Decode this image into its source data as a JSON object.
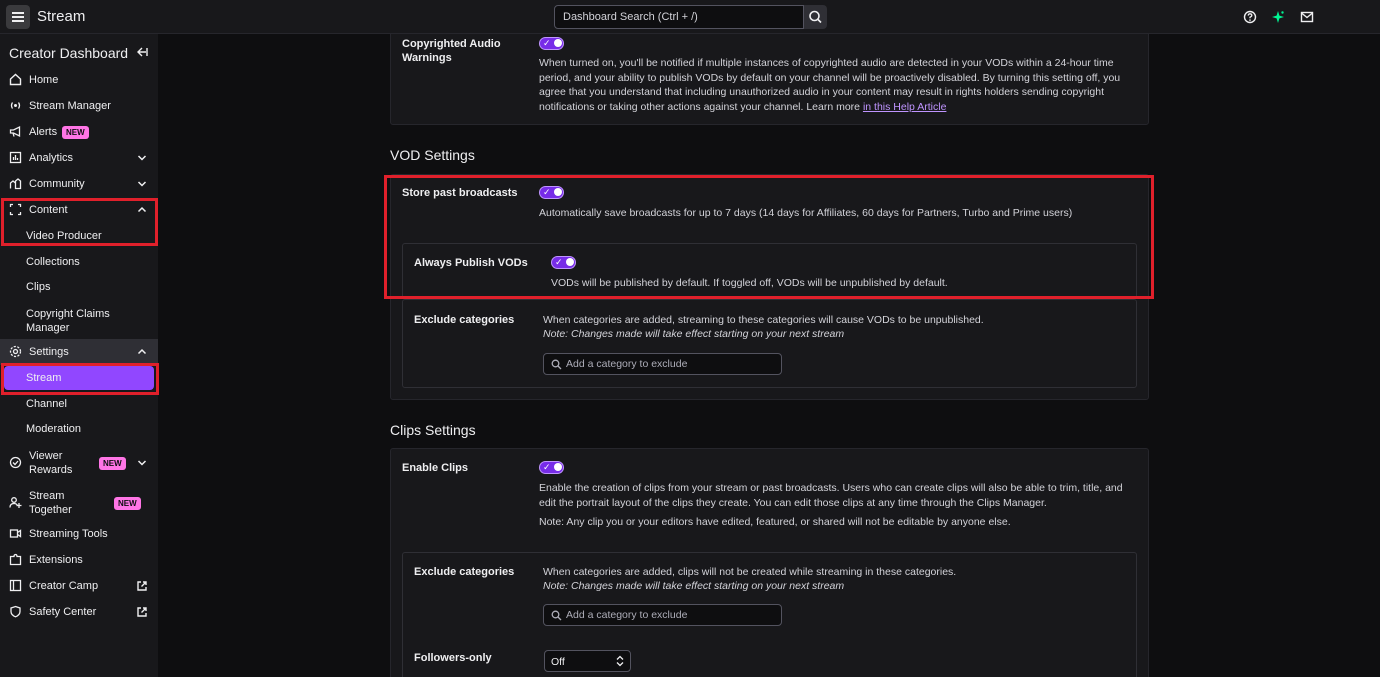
{
  "topbar": {
    "app_name": "Stream",
    "search_placeholder": "Dashboard Search (Ctrl + /)"
  },
  "sidebar": {
    "title": "Creator Dashboard",
    "items": {
      "home": "Home",
      "stream_manager": "Stream Manager",
      "alerts": "Alerts",
      "analytics": "Analytics",
      "community": "Community",
      "content": "Content",
      "video_producer": "Video Producer",
      "collections": "Collections",
      "clips": "Clips",
      "copyright_claims": "Copyright Claims Manager",
      "settings": "Settings",
      "stream": "Stream",
      "channel": "Channel",
      "moderation": "Moderation",
      "viewer_rewards": "Viewer Rewards",
      "stream_together": "Stream Together",
      "streaming_tools": "Streaming Tools",
      "extensions": "Extensions",
      "creator_camp": "Creator Camp",
      "safety_center": "Safety Center"
    },
    "badge_new": "NEW"
  },
  "copyright": {
    "label": "Copyrighted Audio Warnings",
    "desc": "When turned on, you'll be notified if multiple instances of copyrighted audio are detected in your VODs within a 24-hour time period, and your ability to publish VODs by default on your channel will be proactively disabled. By turning this setting off, you agree that you understand that including unauthorized audio in your content may result in rights holders sending copyright notifications or taking other actions against your channel. Learn more",
    "link": "in this Help Article"
  },
  "vod": {
    "heading": "VOD Settings",
    "store_label": "Store past broadcasts",
    "store_desc": "Automatically save broadcasts for up to 7 days (14 days for Affiliates, 60 days for Partners, Turbo and Prime users)",
    "publish_label": "Always Publish VODs",
    "publish_desc": "VODs will be published by default. If toggled off, VODs will be unpublished by default.",
    "exclude_label": "Exclude categories",
    "exclude_desc": "When categories are added, streaming to these categories will cause VODs to be unpublished.",
    "exclude_note": "Note: Changes made will take effect starting on your next stream",
    "exclude_placeholder": "Add a category to exclude"
  },
  "clips": {
    "heading": "Clips Settings",
    "enable_label": "Enable Clips",
    "enable_desc": "Enable the creation of clips from your stream or past broadcasts. Users who can create clips will also be able to trim, title, and edit the portrait layout of the clips they create. You can edit those clips at any time through the Clips Manager.",
    "enable_note": "Note: Any clip you or your editors have edited, featured, or shared will not be editable by anyone else.",
    "exclude_label": "Exclude categories",
    "exclude_desc": "When categories are added, clips will not be created while streaming in these categories.",
    "exclude_note": "Note: Changes made will take effect starting on your next stream",
    "exclude_placeholder": "Add a category to exclude",
    "followers_label": "Followers-only",
    "followers_value": "Off"
  },
  "icons": {
    "menu": "hamburger-icon",
    "search": "search-icon",
    "help": "help-icon",
    "sparkle": "sparkle-icon",
    "inbox": "inbox-icon"
  },
  "colors": {
    "accent": "#9147ff",
    "highlight": "#e0202b",
    "badge": "#ff75e6"
  }
}
